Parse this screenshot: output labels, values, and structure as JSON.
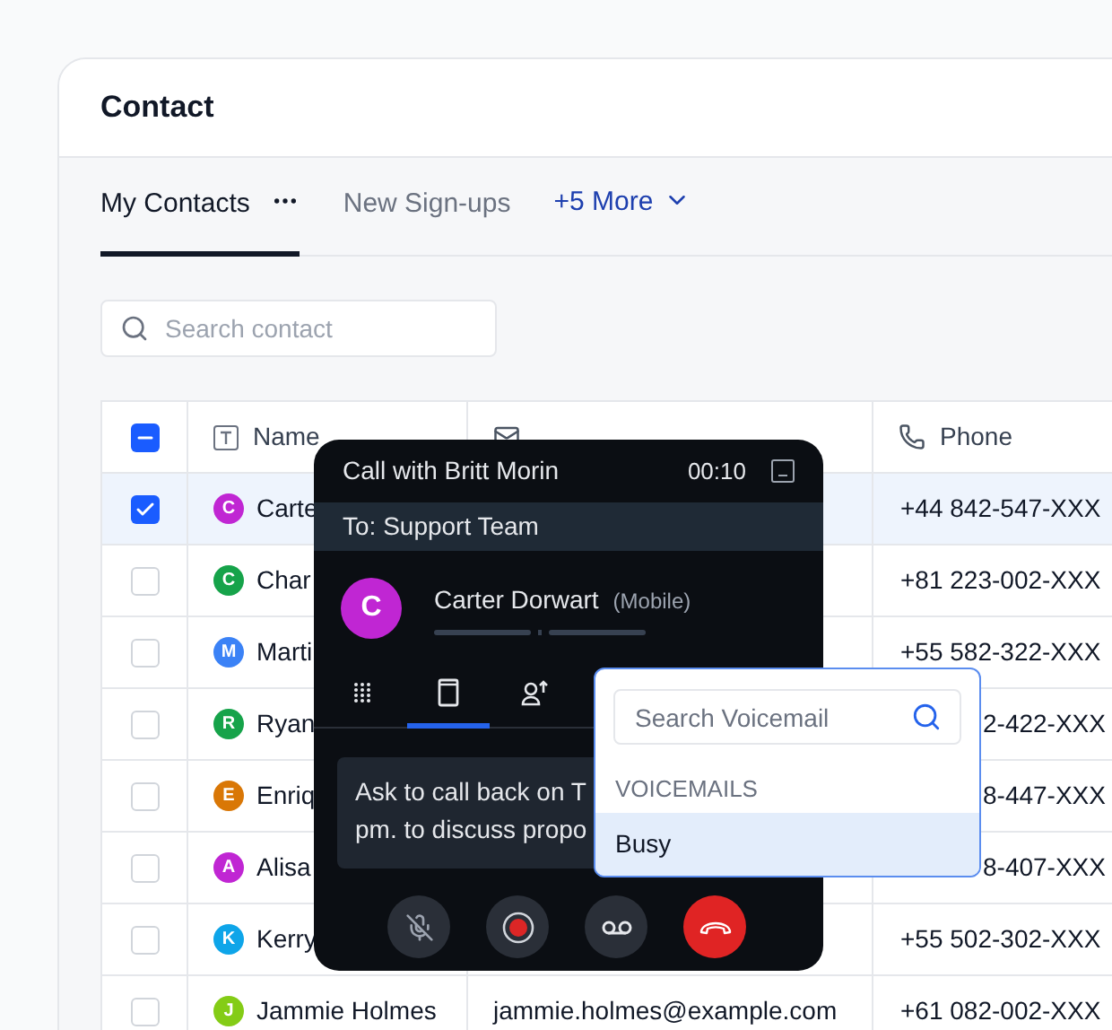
{
  "page": {
    "title": "Contact"
  },
  "tabs": [
    {
      "label": "My Contacts",
      "selected": true,
      "has_menu": true
    },
    {
      "label": "New Sign-ups",
      "selected": false,
      "has_menu": false
    }
  ],
  "more_tabs": {
    "label": "+5 More"
  },
  "search": {
    "placeholder": "Search contact"
  },
  "table": {
    "header_checkbox": {
      "indeterminate": true
    },
    "columns": [
      {
        "label": "Name",
        "kind": "text"
      },
      {
        "kind": "email"
      },
      {
        "label": "Phone",
        "kind": "phone"
      }
    ],
    "rows": [
      {
        "checked": true,
        "selected": true,
        "initial": "C",
        "color": "#c026d3",
        "name": "Carte",
        "phone": "+44 842-547-XXX",
        "phone_covered": false
      },
      {
        "checked": false,
        "selected": false,
        "initial": "C",
        "color": "#16a34a",
        "name": "Char",
        "phone": "+81 223-002-XXX",
        "phone_covered": false
      },
      {
        "checked": false,
        "selected": false,
        "initial": "M",
        "color": "#3b82f6",
        "name": "Marti",
        "phone": "+55 582-322-XXX",
        "phone_covered": false
      },
      {
        "checked": false,
        "selected": false,
        "initial": "R",
        "color": "#16a34a",
        "name": "Ryan",
        "phone": "2-422-XXX",
        "phone_covered": true
      },
      {
        "checked": false,
        "selected": false,
        "initial": "E",
        "color": "#d97706",
        "name": "Enriq",
        "phone": "8-447-XXX",
        "phone_covered": true
      },
      {
        "checked": false,
        "selected": false,
        "initial": "A",
        "color": "#c026d3",
        "name": "Alisa",
        "phone": "8-407-XXX",
        "phone_covered": true
      },
      {
        "checked": false,
        "selected": false,
        "initial": "K",
        "color": "#0ea5e9",
        "name": "Kerry",
        "phone": "+55 502-302-XXX",
        "phone_covered": false
      },
      {
        "checked": false,
        "selected": false,
        "initial": "J",
        "color": "#84cc16",
        "name": "Jammie Holmes",
        "email": "jammie.holmes@example.com",
        "phone": "+61 082-002-XXX",
        "phone_covered": false
      }
    ]
  },
  "call": {
    "title": "Call with Britt Morin",
    "timer": "00:10",
    "to": "To: Support Team",
    "contact": {
      "initial": "C",
      "name": "Carter Dorwart",
      "line": "(Mobile)"
    },
    "tabs": [
      {
        "kind": "dialpad",
        "selected": false
      },
      {
        "kind": "notes",
        "selected": true
      },
      {
        "kind": "transfer",
        "selected": false
      }
    ],
    "note_lines": [
      "Ask to call back on T",
      "pm. to discuss propo"
    ],
    "controls": [
      {
        "kind": "mute"
      },
      {
        "kind": "record"
      },
      {
        "kind": "voicemail"
      },
      {
        "kind": "hangup"
      }
    ]
  },
  "voicemail_menu": {
    "placeholder": "Search Voicemail",
    "section": "VOICEMAILS",
    "items": [
      {
        "label": "Busy",
        "selected": true
      }
    ]
  }
}
